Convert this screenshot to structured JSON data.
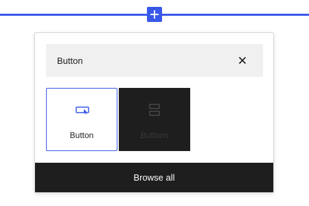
{
  "inserter": {
    "line_color": "#3858e9",
    "plus_icon": "plus-icon"
  },
  "search": {
    "value": "Button",
    "clear_icon": "close-icon"
  },
  "results": [
    {
      "label": "Button",
      "icon": "button-icon",
      "selected": true
    },
    {
      "label": "Buttons",
      "icon": "buttons-icon",
      "selected": false
    }
  ],
  "footer": {
    "browse_all_label": "Browse all"
  },
  "colors": {
    "accent": "#3858e9",
    "dark": "#1e1e1e",
    "search_bg": "#f0f0f0"
  }
}
